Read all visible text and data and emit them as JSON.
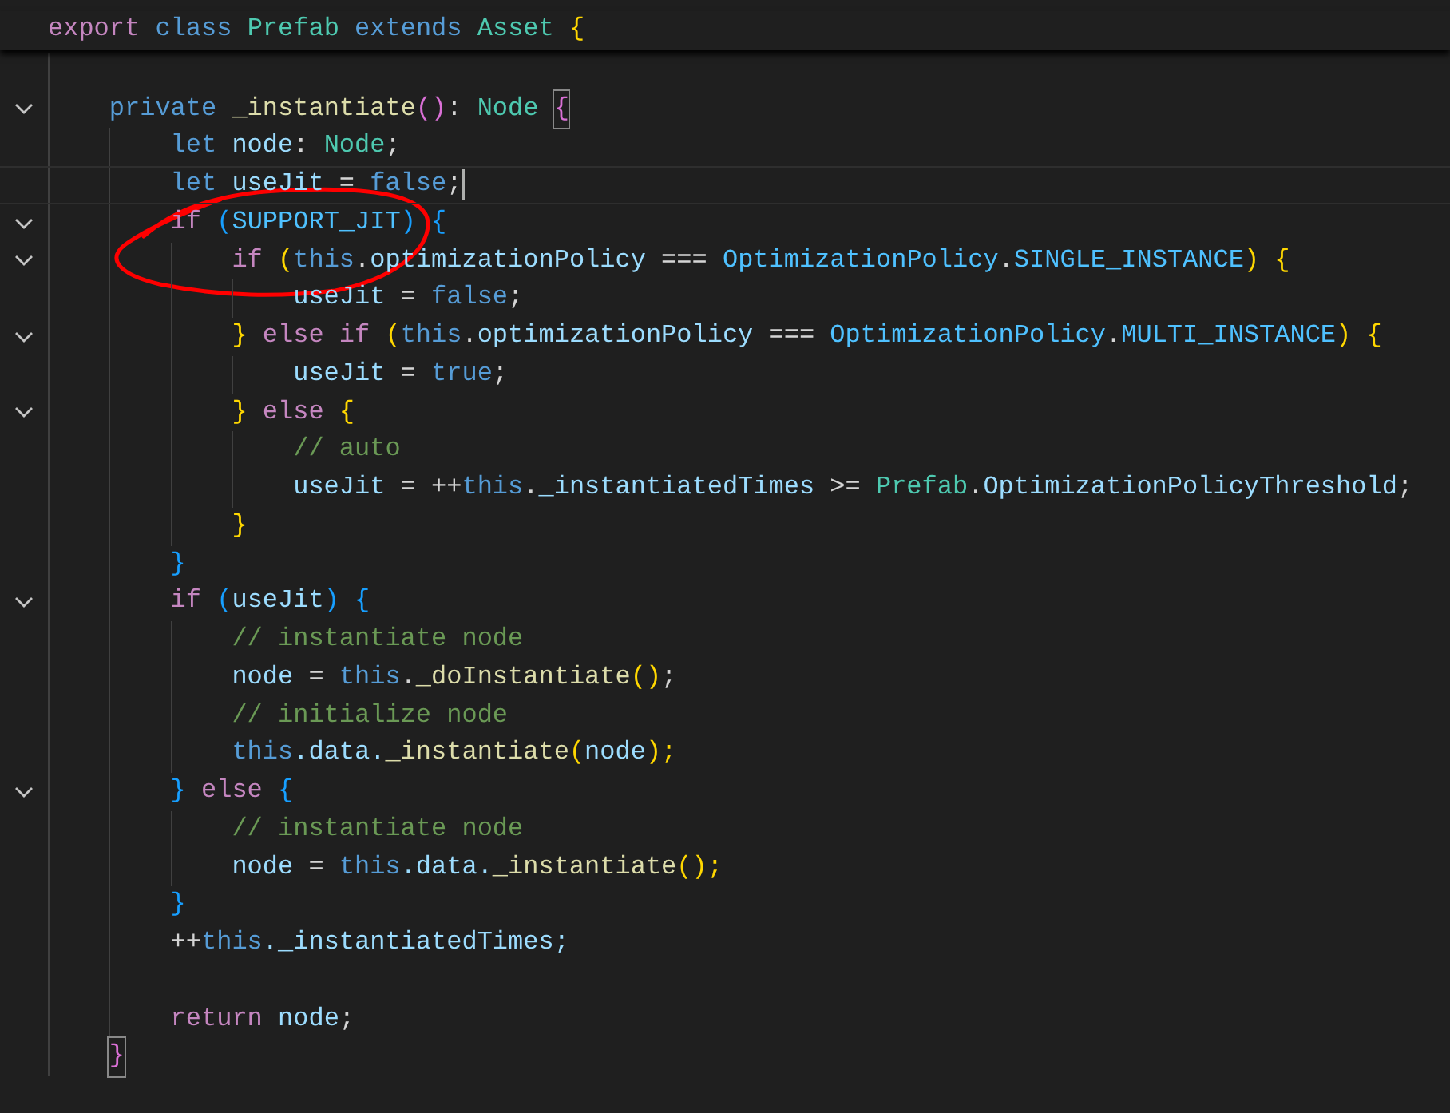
{
  "lines": [
    {
      "fold": false,
      "tokens": [
        {
          "text": "export ",
          "color": "#c586c0"
        },
        {
          "text": "class ",
          "color": "#569cd6"
        },
        {
          "text": "Prefab ",
          "color": "#4ec9b0"
        },
        {
          "text": "extends ",
          "color": "#569cd6"
        },
        {
          "text": "Asset ",
          "color": "#4ec9b0"
        },
        {
          "text": "{",
          "color": "#ffd700"
        }
      ],
      "children": [
        {
          "fold": false
        },
        {
          "fold": true,
          "tokens": [
            {
              "text": "private ",
              "color": "#569cd6"
            },
            {
              "text": "_instantiate",
              "color": "#dcdcaa"
            },
            {
              "text": "()",
              "color": "#da70d6"
            },
            {
              "text": ": ",
              "color": "#d4d4d4"
            },
            {
              "text": "Node ",
              "color": "#4ec9b0"
            },
            {
              "text": "{",
              "color": "#da70d6",
              "matched": true
            }
          ],
          "children": [
            {
              "fold": false,
              "tokens": [
                {
                  "text": "let ",
                  "color": "#569cd6"
                },
                {
                  "text": "node",
                  "color": "#9cdcfe"
                },
                {
                  "text": ": ",
                  "color": "#d4d4d4"
                },
                {
                  "text": "Node",
                  "color": "#4ec9b0"
                },
                {
                  "text": ";",
                  "color": "#d4d4d4"
                }
              ]
            },
            {
              "fold": false,
              "cursor": true,
              "tokens": [
                {
                  "text": "let ",
                  "color": "#569cd6"
                },
                {
                  "text": "useJit",
                  "color": "#9cdcfe"
                },
                {
                  "text": " = ",
                  "color": "#d4d4d4"
                },
                {
                  "text": "false",
                  "color": "#569cd6"
                },
                {
                  "text": ";",
                  "color": "#d4d4d4"
                }
              ]
            },
            {
              "fold": true,
              "tokens": [
                {
                  "text": "if ",
                  "color": "#c586c0"
                },
                {
                  "text": "(",
                  "color": "#179fff"
                },
                {
                  "text": "SUPPORT_JIT",
                  "color": "#4fc1ff"
                },
                {
                  "text": ") {",
                  "color": "#179fff"
                }
              ],
              "children": [
                {
                  "fold": true,
                  "tokens": [
                    {
                      "text": "if ",
                      "color": "#c586c0"
                    },
                    {
                      "text": "(",
                      "color": "#ffd700"
                    },
                    {
                      "text": "this",
                      "color": "#569cd6"
                    },
                    {
                      "text": ".",
                      "color": "#d4d4d4"
                    },
                    {
                      "text": "optimizationPolicy",
                      "color": "#9cdcfe"
                    },
                    {
                      "text": " === ",
                      "color": "#d4d4d4"
                    },
                    {
                      "text": "OptimizationPolicy",
                      "color": "#4fc1ff"
                    },
                    {
                      "text": ".",
                      "color": "#d4d4d4"
                    },
                    {
                      "text": "SINGLE_INSTANCE",
                      "color": "#4fc1ff"
                    },
                    {
                      "text": ") {",
                      "color": "#ffd700"
                    }
                  ],
                  "children": [
                    {
                      "fold": false,
                      "tokens": [
                        {
                          "text": "useJit",
                          "color": "#9cdcfe"
                        },
                        {
                          "text": " = ",
                          "color": "#d4d4d4"
                        },
                        {
                          "text": "false",
                          "color": "#569cd6"
                        },
                        {
                          "text": ";",
                          "color": "#d4d4d4"
                        }
                      ]
                    }
                  ]
                },
                {
                  "fold": true,
                  "tokens": [
                    {
                      "text": "} ",
                      "color": "#ffd700"
                    },
                    {
                      "text": "else if ",
                      "color": "#c586c0"
                    },
                    {
                      "text": "(",
                      "color": "#ffd700"
                    },
                    {
                      "text": "this",
                      "color": "#569cd6"
                    },
                    {
                      "text": ".",
                      "color": "#d4d4d4"
                    },
                    {
                      "text": "optimizationPolicy",
                      "color": "#9cdcfe"
                    },
                    {
                      "text": " === ",
                      "color": "#d4d4d4"
                    },
                    {
                      "text": "OptimizationPolicy",
                      "color": "#4fc1ff"
                    },
                    {
                      "text": ".",
                      "color": "#d4d4d4"
                    },
                    {
                      "text": "MULTI_INSTANCE",
                      "color": "#4fc1ff"
                    },
                    {
                      "text": ") {",
                      "color": "#ffd700"
                    }
                  ],
                  "children": [
                    {
                      "fold": false,
                      "tokens": [
                        {
                          "text": "useJit",
                          "color": "#9cdcfe"
                        },
                        {
                          "text": " = ",
                          "color": "#d4d4d4"
                        },
                        {
                          "text": "true",
                          "color": "#569cd6"
                        },
                        {
                          "text": ";",
                          "color": "#d4d4d4"
                        }
                      ]
                    }
                  ]
                },
                {
                  "fold": true,
                  "tokens": [
                    {
                      "text": "} ",
                      "color": "#ffd700"
                    },
                    {
                      "text": "else ",
                      "color": "#c586c0"
                    },
                    {
                      "text": "{",
                      "color": "#ffd700"
                    }
                  ],
                  "children": [
                    {
                      "fold": false,
                      "tokens": [
                        {
                          "text": "// auto",
                          "color": "#6a9955"
                        }
                      ]
                    },
                    {
                      "fold": false,
                      "tokens": [
                        {
                          "text": "useJit",
                          "color": "#9cdcfe"
                        },
                        {
                          "text": " = ++",
                          "color": "#d4d4d4"
                        },
                        {
                          "text": "this",
                          "color": "#569cd6"
                        },
                        {
                          "text": ".",
                          "color": "#d4d4d4"
                        },
                        {
                          "text": "_instantiatedTimes",
                          "color": "#9cdcfe"
                        },
                        {
                          "text": " >= ",
                          "color": "#d4d4d4"
                        },
                        {
                          "text": "Prefab",
                          "color": "#4ec9b0"
                        },
                        {
                          "text": ".",
                          "color": "#d4d4d4"
                        },
                        {
                          "text": "OptimizationPolicyThreshold",
                          "color": "#9cdcfe"
                        },
                        {
                          "text": ";",
                          "color": "#d4d4d4"
                        }
                      ]
                    }
                  ]
                },
                {
                  "fold": false,
                  "tokens": [
                    {
                      "text": "}",
                      "color": "#ffd700"
                    }
                  ]
                }
              ]
            },
            {
              "fold": false,
              "tokens": [
                {
                  "text": "}",
                  "color": "#179fff"
                }
              ]
            },
            {
              "fold": true,
              "tokens": [
                {
                  "text": "if ",
                  "color": "#c586c0"
                },
                {
                  "text": "(",
                  "color": "#179fff"
                },
                {
                  "text": "useJit",
                  "color": "#9cdcfe"
                },
                {
                  "text": ") {",
                  "color": "#179fff"
                }
              ],
              "children": [
                {
                  "fold": false,
                  "tokens": [
                    {
                      "text": "// instantiate node",
                      "color": "#6a9955"
                    }
                  ]
                },
                {
                  "fold": false,
                  "tokens": [
                    {
                      "text": "node",
                      "color": "#9cdcfe"
                    },
                    {
                      "text": " = ",
                      "color": "#d4d4d4"
                    },
                    {
                      "text": "this",
                      "color": "#569cd6"
                    },
                    {
                      "text": ".",
                      "color": "#d4d4d4"
                    },
                    {
                      "text": "_doInstantiate",
                      "color": "#dcdcaa"
                    },
                    {
                      "text": "()",
                      "color": "#ffd700"
                    },
                    {
                      "text": ";",
                      "color": "#d4d4d4"
                    }
                  ]
                },
                {
                  "fold": false,
                  "tokens": [
                    {
                      "text": "// initialize node",
                      "color": "#6a9955"
                    }
                  ]
                },
                {
                  "fold": false,
                  "tokens": [
                    {
                      "text": "this",
                      "color": "#569cd6"
                    },
                    {
                      "text": ".data.",
                      "color": "#9cdcfe"
                    },
                    {
                      "text": "_instantiate",
                      "color": "#dcdcaa"
                    },
                    {
                      "text": "(",
                      "color": "#ffd700"
                    },
                    {
                      "text": "node",
                      "color": "#9cdcfe"
                    },
                    {
                      "text": ");",
                      "color": "#ffd700"
                    }
                  ]
                }
              ]
            },
            {
              "fold": true,
              "tokens": [
                {
                  "text": "} ",
                  "color": "#179fff"
                },
                {
                  "text": "else ",
                  "color": "#c586c0"
                },
                {
                  "text": "{",
                  "color": "#179fff"
                }
              ],
              "children": [
                {
                  "fold": false,
                  "tokens": [
                    {
                      "text": "// instantiate node",
                      "color": "#6a9955"
                    }
                  ]
                },
                {
                  "fold": false,
                  "tokens": [
                    {
                      "text": "node",
                      "color": "#9cdcfe"
                    },
                    {
                      "text": " = ",
                      "color": "#d4d4d4"
                    },
                    {
                      "text": "this",
                      "color": "#569cd6"
                    },
                    {
                      "text": ".data.",
                      "color": "#9cdcfe"
                    },
                    {
                      "text": "_instantiate",
                      "color": "#dcdcaa"
                    },
                    {
                      "text": "();",
                      "color": "#ffd700"
                    }
                  ]
                }
              ]
            },
            {
              "fold": false,
              "tokens": [
                {
                  "text": "}",
                  "color": "#179fff"
                }
              ]
            },
            {
              "fold": false,
              "tokens": [
                {
                  "text": "++",
                  "color": "#d4d4d4"
                },
                {
                  "text": "this",
                  "color": "#569cd6"
                },
                {
                  "text": "._instantiatedTimes;",
                  "color": "#9cdcfe"
                }
              ]
            },
            {
              "fold": false
            },
            {
              "fold": false,
              "tokens": [
                {
                  "text": "return ",
                  "color": "#c586c0"
                },
                {
                  "text": "node",
                  "color": "#9cdcfe"
                },
                {
                  "text": ";",
                  "color": "#d4d4d4"
                }
              ]
            }
          ]
        },
        {
          "fold": false,
          "tokens": [
            {
              "text": "}",
              "color": "#da70d6",
              "matched": true
            }
          ]
        }
      ]
    }
  ]
}
